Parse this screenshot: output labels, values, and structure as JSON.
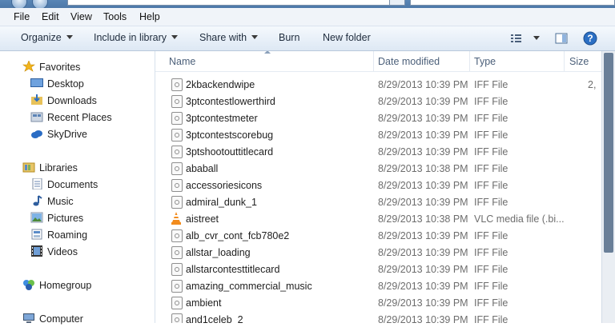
{
  "menu": [
    "File",
    "Edit",
    "View",
    "Tools",
    "Help"
  ],
  "toolbar": {
    "organize": "Organize",
    "include": "Include in library",
    "share": "Share with",
    "burn": "Burn",
    "new_folder": "New folder"
  },
  "nav": {
    "favorites": "Favorites",
    "desktop": "Desktop",
    "downloads": "Downloads",
    "recent": "Recent Places",
    "skydrive": "SkyDrive",
    "libraries": "Libraries",
    "documents": "Documents",
    "music": "Music",
    "pictures": "Pictures",
    "roaming": "Roaming",
    "videos": "Videos",
    "homegroup": "Homegroup",
    "computer": "Computer"
  },
  "columns": {
    "name": "Name",
    "date": "Date modified",
    "type": "Type",
    "size": "Size"
  },
  "files": [
    {
      "name": "2kbackendwipe",
      "date": "8/29/2013 10:39 PM",
      "type": "IFF File",
      "size": "2,",
      "icon": "file-icon"
    },
    {
      "name": "3ptcontestlowerthird",
      "date": "8/29/2013 10:39 PM",
      "type": "IFF File",
      "size": "",
      "icon": "file-icon"
    },
    {
      "name": "3ptcontestmeter",
      "date": "8/29/2013 10:39 PM",
      "type": "IFF File",
      "size": "",
      "icon": "file-icon"
    },
    {
      "name": "3ptcontestscorebug",
      "date": "8/29/2013 10:39 PM",
      "type": "IFF File",
      "size": "",
      "icon": "file-icon"
    },
    {
      "name": "3ptshootouttitlecard",
      "date": "8/29/2013 10:39 PM",
      "type": "IFF File",
      "size": "",
      "icon": "file-icon"
    },
    {
      "name": "ababall",
      "date": "8/29/2013 10:38 PM",
      "type": "IFF File",
      "size": "",
      "icon": "file-icon"
    },
    {
      "name": "accessoriesicons",
      "date": "8/29/2013 10:39 PM",
      "type": "IFF File",
      "size": "",
      "icon": "file-icon"
    },
    {
      "name": "admiral_dunk_1",
      "date": "8/29/2013 10:39 PM",
      "type": "IFF File",
      "size": "",
      "icon": "file-icon"
    },
    {
      "name": "aistreet",
      "date": "8/29/2013 10:38 PM",
      "type": "VLC media file (.bi...",
      "size": "",
      "icon": "vlc-cone-icon"
    },
    {
      "name": "alb_cvr_cont_fcb780e2",
      "date": "8/29/2013 10:39 PM",
      "type": "IFF File",
      "size": "",
      "icon": "file-icon"
    },
    {
      "name": "allstar_loading",
      "date": "8/29/2013 10:39 PM",
      "type": "IFF File",
      "size": "",
      "icon": "file-icon"
    },
    {
      "name": "allstarcontesttitlecard",
      "date": "8/29/2013 10:39 PM",
      "type": "IFF File",
      "size": "",
      "icon": "file-icon"
    },
    {
      "name": "amazing_commercial_music",
      "date": "8/29/2013 10:39 PM",
      "type": "IFF File",
      "size": "",
      "icon": "file-icon"
    },
    {
      "name": "ambient",
      "date": "8/29/2013 10:39 PM",
      "type": "IFF File",
      "size": "",
      "icon": "file-icon"
    },
    {
      "name": "and1celeb_2",
      "date": "8/29/2013 10:39 PM",
      "type": "IFF File",
      "size": "",
      "icon": "file-icon"
    }
  ]
}
